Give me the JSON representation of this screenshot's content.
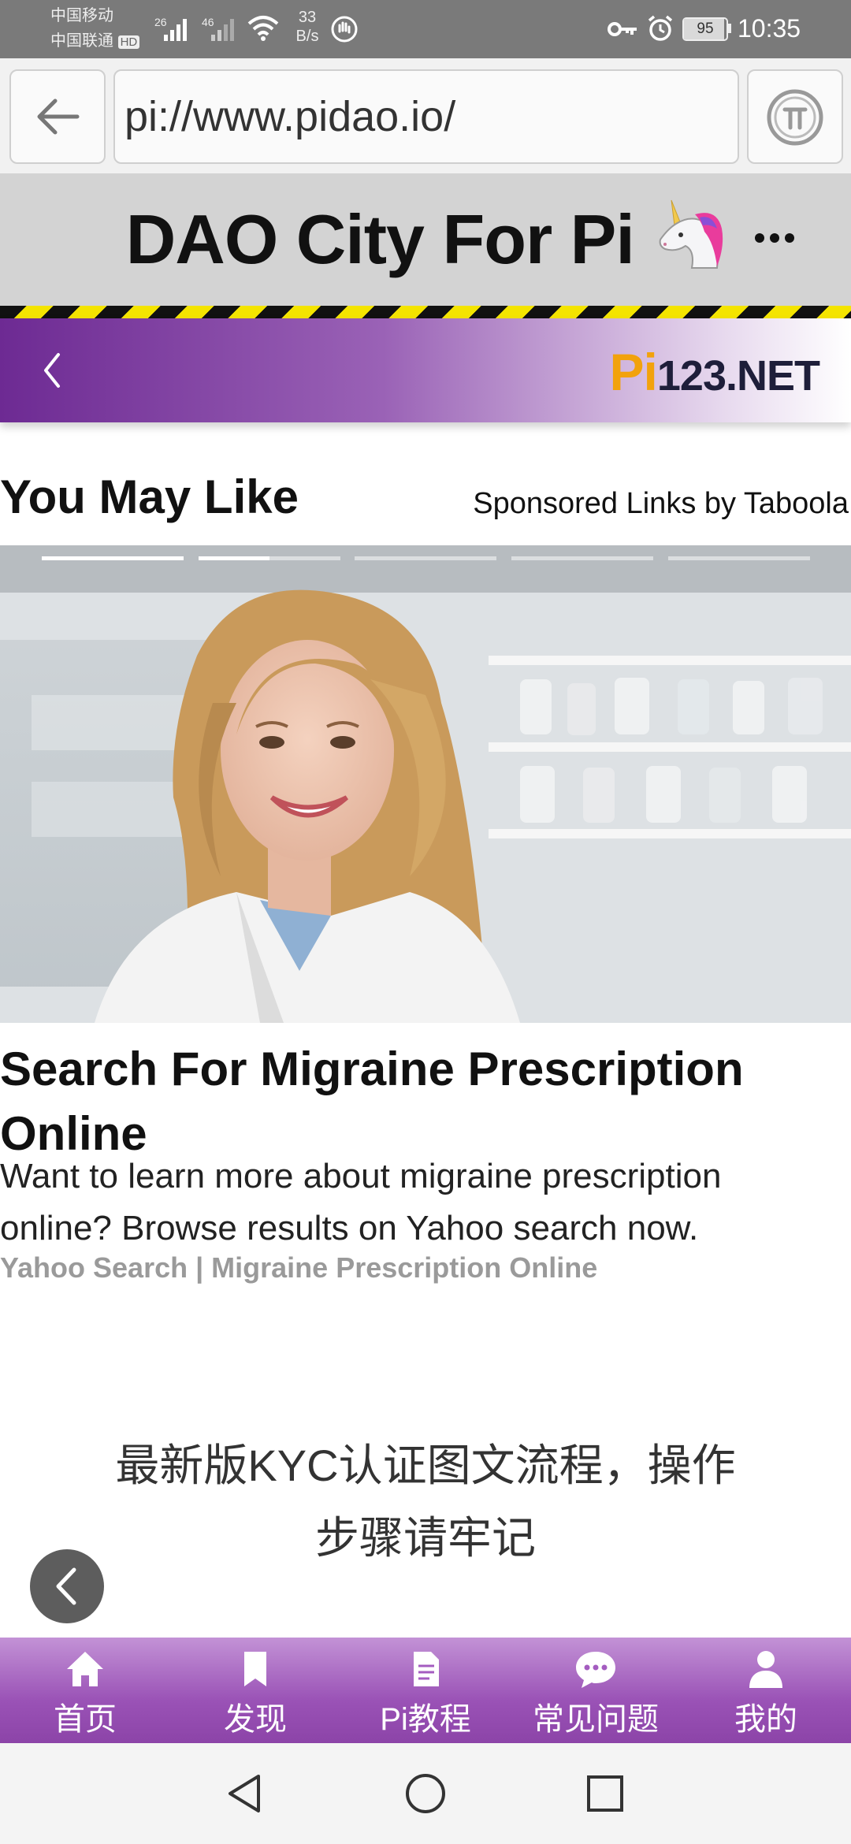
{
  "status_bar": {
    "carrier1": "中国移动",
    "carrier2": "中国联通",
    "hd": "HD",
    "net1": "26",
    "net2": "46",
    "speed_value": "33",
    "speed_unit": "B/s",
    "battery": "95",
    "time": "10:35"
  },
  "browser": {
    "url": "pi://www.pidao.io/",
    "back_icon": "arrow-left-icon",
    "pi_icon": "pi-coin-icon"
  },
  "site": {
    "title": "DAO City For Pi",
    "menu_icon": "more-dots-icon"
  },
  "banner": {
    "logo_pi": "Pi",
    "logo_rest": "123.NET"
  },
  "you_may_like": {
    "title": "You May Like",
    "sponsor": "Sponsored Links by Taboola",
    "carousel_progress": 0.5,
    "carousel_count": 5,
    "carousel_active_index": 1
  },
  "ad": {
    "title": "Search For Migraine Prescription Online",
    "body": "Want to learn more about migraine prescription online? Browse results on Yahoo search now.",
    "source": "Yahoo Search | Migraine Prescription Online"
  },
  "article": {
    "title": "最新版KYC认证图文流程，操作步骤请牢记"
  },
  "bottom_nav": {
    "items": [
      {
        "label": "首页",
        "icon": "home-icon"
      },
      {
        "label": "发现",
        "icon": "bookmark-icon"
      },
      {
        "label": "Pi教程",
        "icon": "document-icon"
      },
      {
        "label": "常见问题",
        "icon": "chat-icon"
      },
      {
        "label": "我的",
        "icon": "user-icon"
      }
    ]
  },
  "colors": {
    "purple": "#8c44a8",
    "hazard_yellow": "#f4e400",
    "logo_orange": "#f2a20c"
  }
}
